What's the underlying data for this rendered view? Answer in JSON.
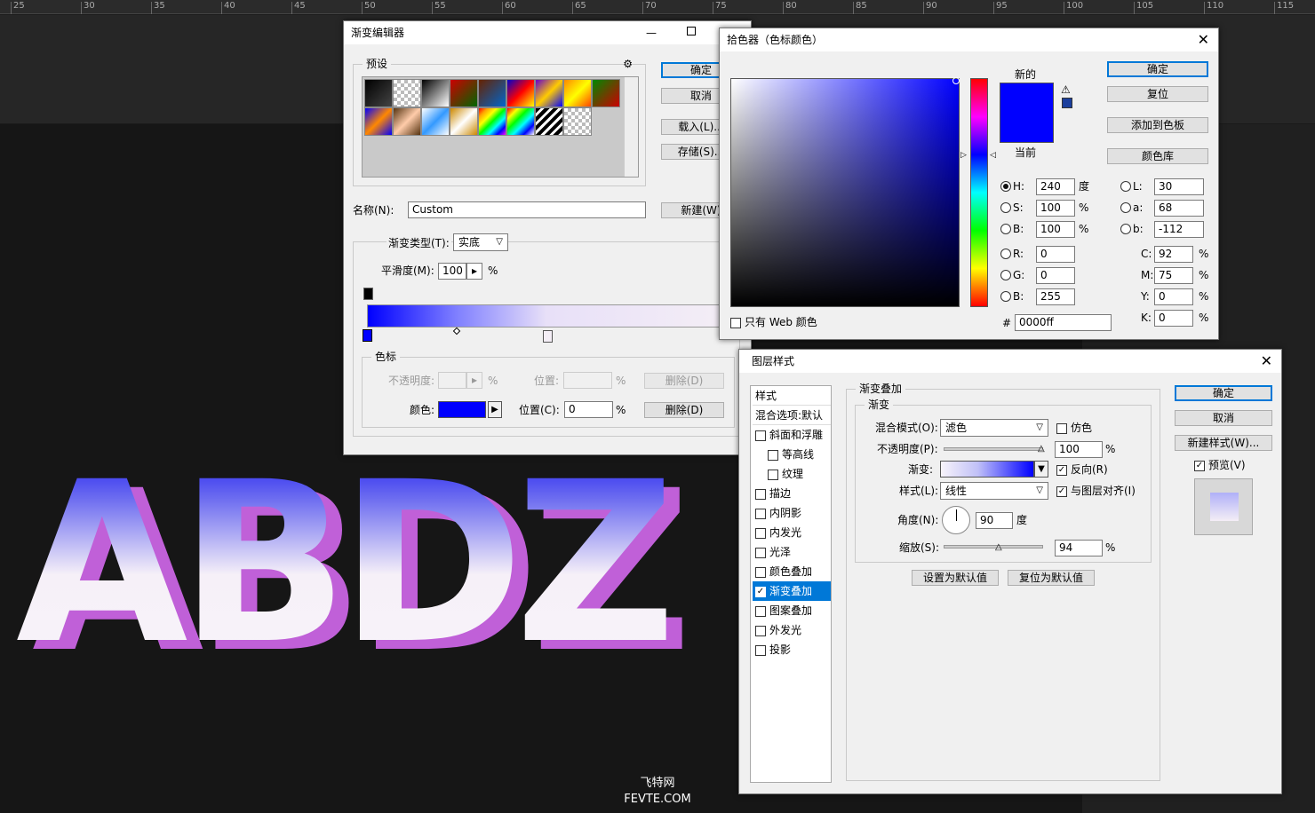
{
  "ruler": {
    "ticks": [
      "25",
      "30",
      "35",
      "40",
      "45",
      "50",
      "55",
      "60",
      "65",
      "70",
      "75",
      "80",
      "85",
      "90",
      "95",
      "100",
      "105",
      "110",
      "115"
    ]
  },
  "artwork": {
    "text": "ABDZ"
  },
  "watermark": {
    "line1": "飞特网",
    "line2": "FEVTE.COM"
  },
  "gradient_editor": {
    "title": "渐变编辑器",
    "presets_label": "预设",
    "ok": "确定",
    "cancel": "取消",
    "load": "载入(L)...",
    "save": "存储(S)...",
    "name_label": "名称(N):",
    "name_value": "Custom",
    "new_button": "新建(W)",
    "type_label": "渐变类型(T):",
    "type_value": "实底",
    "smooth_label": "平滑度(M):",
    "smooth_value": "100",
    "smooth_unit": "%",
    "stops_group": "色标",
    "opacity_label": "不透明度:",
    "opacity_unit": "%",
    "position_label": "位置:",
    "position_unit": "%",
    "delete_label": "删除(D)",
    "color_label": "颜色:",
    "color_position_label": "位置(C):",
    "color_position_value": "0",
    "color_position_unit": "%",
    "delete2_label": "删除(D)",
    "stop_color": "#0000ff"
  },
  "color_picker": {
    "title": "拾色器（色标颜色）",
    "new_label": "新的",
    "current_label": "当前",
    "ok": "确定",
    "reset": "复位",
    "add_swatch": "添加到色板",
    "color_library": "颜色库",
    "hsb": [
      {
        "label": "H:",
        "value": "240",
        "unit": "度",
        "checked": true
      },
      {
        "label": "S:",
        "value": "100",
        "unit": "%",
        "checked": false
      },
      {
        "label": "B:",
        "value": "100",
        "unit": "%",
        "checked": false
      }
    ],
    "rgb": [
      {
        "label": "R:",
        "value": "0"
      },
      {
        "label": "G:",
        "value": "0"
      },
      {
        "label": "B:",
        "value": "255"
      }
    ],
    "lab": [
      {
        "label": "L:",
        "value": "30"
      },
      {
        "label": "a:",
        "value": "68"
      },
      {
        "label": "b:",
        "value": "-112"
      }
    ],
    "cmyk": [
      {
        "label": "C:",
        "value": "92",
        "unit": "%"
      },
      {
        "label": "M:",
        "value": "75",
        "unit": "%"
      },
      {
        "label": "Y:",
        "value": "0",
        "unit": "%"
      },
      {
        "label": "K:",
        "value": "0",
        "unit": "%"
      }
    ],
    "hex_label": "#",
    "hex_value": "0000ff",
    "web_only_label": "只有 Web 颜色",
    "new_color": "#0000ff",
    "current_color": "#0000ff"
  },
  "layer_style": {
    "title": "图层样式",
    "styles_header": "样式",
    "blend_default": "混合选项:默认",
    "items": [
      {
        "label": "斜面和浮雕",
        "checked": false,
        "indent": false,
        "active": false
      },
      {
        "label": "等高线",
        "checked": false,
        "indent": true,
        "active": false
      },
      {
        "label": "纹理",
        "checked": false,
        "indent": true,
        "active": false
      },
      {
        "label": "描边",
        "checked": false,
        "indent": false,
        "active": false
      },
      {
        "label": "内阴影",
        "checked": false,
        "indent": false,
        "active": false
      },
      {
        "label": "内发光",
        "checked": false,
        "indent": false,
        "active": false
      },
      {
        "label": "光泽",
        "checked": false,
        "indent": false,
        "active": false
      },
      {
        "label": "颜色叠加",
        "checked": false,
        "indent": false,
        "active": false
      },
      {
        "label": "渐变叠加",
        "checked": true,
        "indent": false,
        "active": true
      },
      {
        "label": "图案叠加",
        "checked": false,
        "indent": false,
        "active": false
      },
      {
        "label": "外发光",
        "checked": false,
        "indent": false,
        "active": false
      },
      {
        "label": "投影",
        "checked": false,
        "indent": false,
        "active": false
      }
    ],
    "section_title": "渐变叠加",
    "sub_title": "渐变",
    "blend_mode_label": "混合模式(O):",
    "blend_mode_value": "滤色",
    "dither_label": "仿色",
    "opacity_label": "不透明度(P):",
    "opacity_value": "100",
    "opacity_unit": "%",
    "gradient_label": "渐变:",
    "reverse_label": "反向(R)",
    "style_label": "样式(L):",
    "style_value": "线性",
    "align_label": "与图层对齐(I)",
    "angle_label": "角度(N):",
    "angle_value": "90",
    "angle_unit": "度",
    "scale_label": "缩放(S):",
    "scale_value": "94",
    "scale_unit": "%",
    "set_default": "设置为默认值",
    "reset_default": "复位为默认值",
    "ok": "确定",
    "cancel": "取消",
    "new_style": "新建样式(W)...",
    "preview_label": "预览(V)"
  }
}
